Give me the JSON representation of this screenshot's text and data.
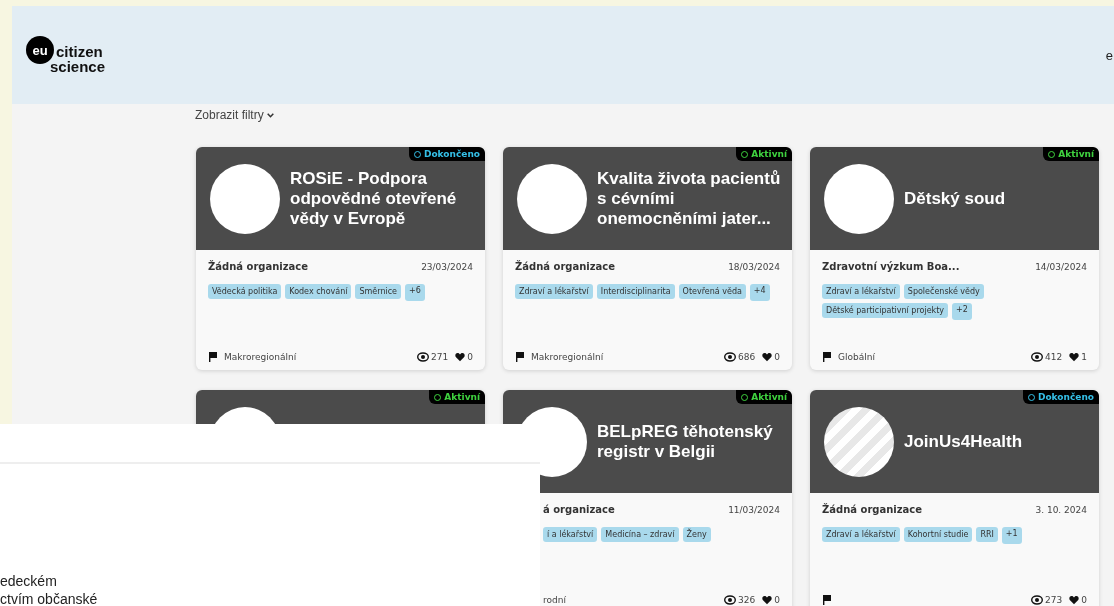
{
  "header": {
    "logo_badge": "eu",
    "logo_lines": [
      "citizen",
      "science"
    ],
    "nav_partial": "e"
  },
  "filters_toggle": "Zobrazit filtry",
  "projects": [
    {
      "status": {
        "kind": "completed",
        "label": "Dokončeno"
      },
      "title": "ROSiE - Podpora odpovědné otevřené vědy v Evropě",
      "organization": "Žádná organizace",
      "date": "23/03/2024",
      "tags": [
        "Vědecká politika",
        "Kodex chování",
        "Směrnice"
      ],
      "more": "+6",
      "scope": "Makroregionální",
      "views": "271",
      "likes": "0"
    },
    {
      "status": {
        "kind": "active",
        "label": "Aktivní"
      },
      "title": "Kvalita života pacientů s cévními onemocněními jater...",
      "organization": "Žádná organizace",
      "date": "18/03/2024",
      "tags": [
        "Zdraví a lékařství",
        "Interdisciplinarita",
        "Otevřená věda"
      ],
      "more": "+4",
      "scope": "Makroregionální",
      "views": "686",
      "likes": "0"
    },
    {
      "status": {
        "kind": "active",
        "label": "Aktivní"
      },
      "title": "Dětský soud",
      "organization": "Zdravotní výzkum Boa...",
      "date": "14/03/2024",
      "tags": [
        "Zdraví a lékařství",
        "Společenské vědy",
        "Dětské participativní projekty"
      ],
      "more": "+2",
      "scope": "Globální",
      "views": "412",
      "likes": "1"
    },
    {
      "status": {
        "kind": "active",
        "label": "Aktivní"
      }
    },
    {
      "status": {
        "kind": "active",
        "label": "Aktivní"
      },
      "title": "BELpREG těhotenský registr v Belgii",
      "organization": "á organizace",
      "date": "11/03/2024",
      "tags": [
        "í a lékařství",
        "Medicína – zdraví",
        "Ženy"
      ],
      "scope": "rodní",
      "views": "326",
      "likes": "0"
    },
    {
      "status": {
        "kind": "completed",
        "label": "Dokončeno"
      },
      "title": "JoinUs4Health",
      "organization": "Žádná organizace",
      "date": "3. 10. 2024",
      "tags": [
        "Zdraví a lékařství",
        "Kohortní studie",
        "RRI"
      ],
      "more": "+1",
      "views": "273",
      "likes": "0"
    }
  ],
  "overlay": {
    "lines": [
      "edeckém",
      "ctvím občanské"
    ]
  }
}
